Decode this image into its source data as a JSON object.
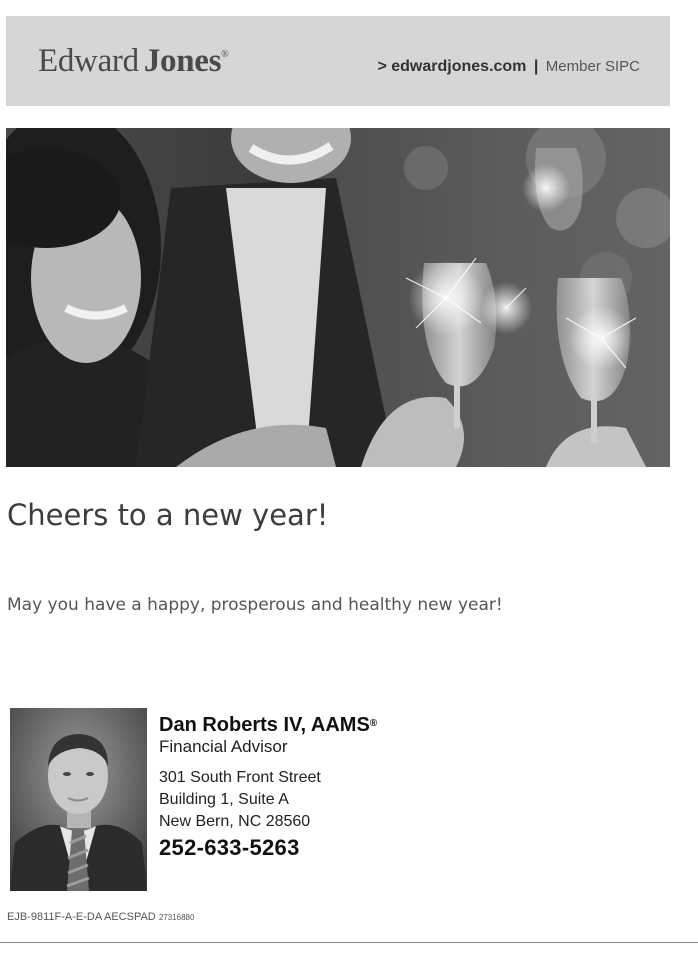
{
  "header": {
    "logo": {
      "word1": "Edward",
      "word2": "Jones",
      "reg": "®"
    },
    "site_link": "> edwardjones.com",
    "separator": "|",
    "member": "Member SIPC"
  },
  "hero": {
    "image": "photo-celebration-champagne-sparklers"
  },
  "headline": "Cheers to a new year!",
  "message": "May you have a happy, prosperous and healthy new year!",
  "advisor": {
    "photo": "advisor-portrait",
    "name": "Dan Roberts IV, AAMS",
    "reg": "®",
    "title": "Financial Advisor",
    "address": [
      "301 South Front Street",
      "Building 1, Suite A",
      "New Bern, NC 28560"
    ],
    "phone": "252-633-5263"
  },
  "footer": {
    "code": "EJB-9811F-A-E-DA AECSPAD",
    "code_small": "27316880"
  },
  "colors": {
    "header_bg": "#d6d6d6",
    "text_dark": "#111111",
    "text_gray": "#555555"
  }
}
